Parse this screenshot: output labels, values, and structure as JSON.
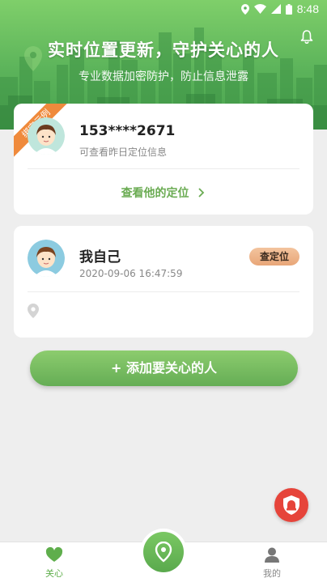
{
  "status_bar": {
    "time": "8:48"
  },
  "header": {
    "title": "实时位置更新，守护关心的人",
    "subtitle": "专业数据加密防护，防止信息泄露"
  },
  "example_card": {
    "ribbon": "绑定示例",
    "phone": "153****2671",
    "hint": "可查看昨日定位信息",
    "view_location": "查看他的定位"
  },
  "self_card": {
    "name": "我自己",
    "timestamp": "2020-09-06 16:47:59",
    "check_button": "查定位"
  },
  "add_button": "+ 添加要关心的人",
  "tabbar": {
    "care_label": "关心",
    "mine_label": "我的"
  },
  "colors": {
    "brand_green": "#5fae4c",
    "ribbon_orange": "#ef8a3c",
    "sos_red": "#e6443a",
    "check_orange": "#e8a678"
  }
}
